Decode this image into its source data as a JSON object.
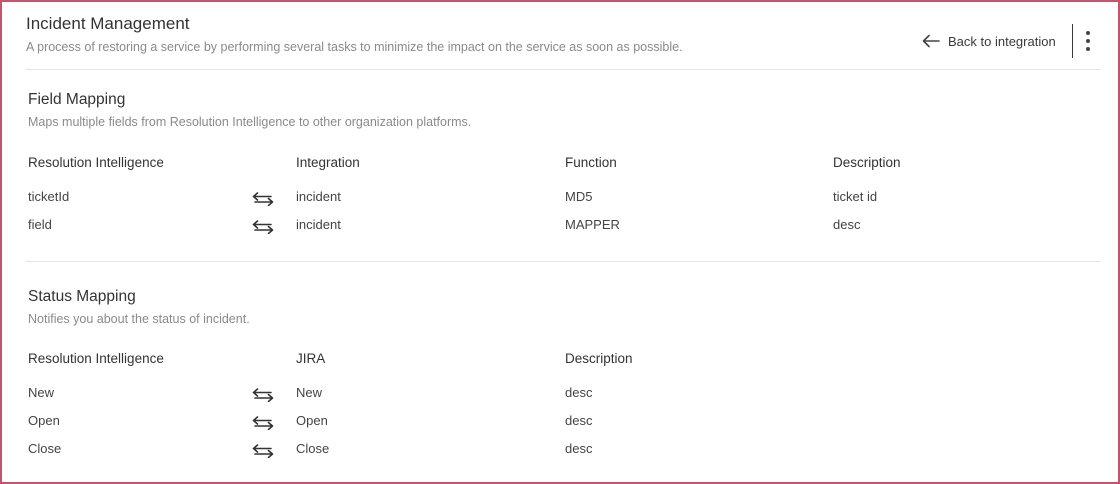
{
  "header": {
    "title": "Incident Management",
    "subtitle": "A process of restoring a service by performing several tasks to minimize the impact on the service as soon as possible.",
    "back_label": "Back to integration"
  },
  "icons": {
    "back": "arrow-left-icon",
    "more": "more-vertical-icon",
    "mapping": "bidirectional-arrow-icon"
  },
  "colors": {
    "frame_border": "#c9536f"
  },
  "field_mapping": {
    "title": "Field Mapping",
    "description": "Maps multiple fields from Resolution Intelligence to other organization platforms.",
    "columns": [
      "Resolution Intelligence",
      "Integration",
      "Function",
      "Description"
    ],
    "rows": [
      [
        "ticketId",
        "incident",
        "MD5",
        "ticket id"
      ],
      [
        "field",
        "incident",
        "MAPPER",
        "desc"
      ]
    ]
  },
  "status_mapping": {
    "title": "Status Mapping",
    "description": "Notifies you about the status of incident.",
    "columns": [
      "Resolution Intelligence",
      "JIRA",
      "Description"
    ],
    "rows": [
      [
        "New",
        "New",
        "desc"
      ],
      [
        "Open",
        "Open",
        "desc"
      ],
      [
        "Close",
        "Close",
        "desc"
      ]
    ]
  }
}
